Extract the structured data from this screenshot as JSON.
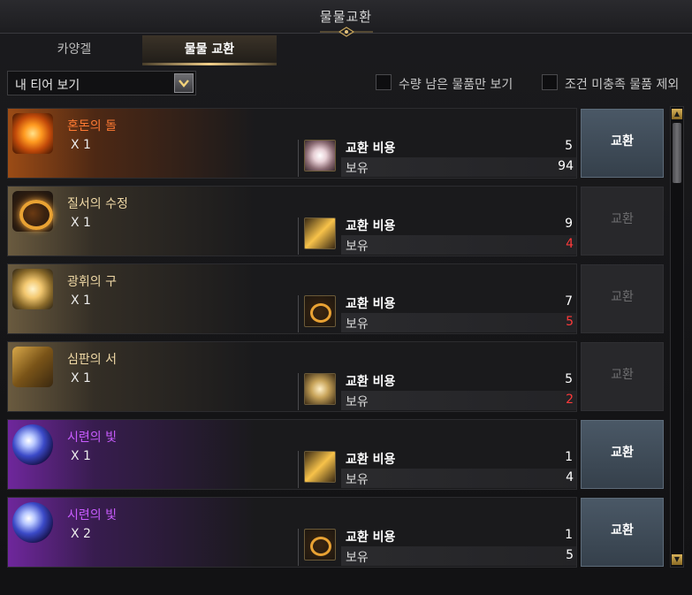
{
  "window": {
    "title": "물물교환",
    "close_icon": "close-icon"
  },
  "tabs": [
    {
      "label": "카양겔",
      "active": false
    },
    {
      "label": "물물 교환",
      "active": true
    }
  ],
  "filters": {
    "tier_select": {
      "value": "내 티어 보기"
    },
    "checkbox_remaining": {
      "label": "수량 남은 물품만 보기",
      "checked": false
    },
    "checkbox_unmet": {
      "label": "조건 미충족 물품 제외",
      "checked": false
    }
  },
  "items": [
    {
      "name": "혼돈의 돌",
      "qty": "X 1",
      "rarity_color": "#ff7a33",
      "icon": "chaos-stone-icon",
      "cost_icon": "gem-icon",
      "cost_label": "교환 비용",
      "cost_value": "5",
      "owned_label": "보유",
      "owned_value": "94",
      "sufficient": true,
      "button_label": "교환",
      "button_enabled": true
    },
    {
      "name": "질서의 수정",
      "qty": "X 1",
      "rarity_color": "#f0d9a6",
      "icon": "order-crystal-icon",
      "cost_icon": "blade-icon",
      "cost_label": "교환 비용",
      "cost_value": "9",
      "owned_label": "보유",
      "owned_value": "4",
      "sufficient": false,
      "button_label": "교환",
      "button_enabled": false
    },
    {
      "name": "광휘의 구",
      "qty": "X 1",
      "rarity_color": "#f0d9a6",
      "icon": "radiance-orb-icon",
      "cost_icon": "ring-icon",
      "cost_label": "교환 비용",
      "cost_value": "7",
      "owned_label": "보유",
      "owned_value": "5",
      "sufficient": false,
      "button_label": "교환",
      "button_enabled": false
    },
    {
      "name": "심판의 서",
      "qty": "X 1",
      "rarity_color": "#f0d9a6",
      "icon": "judgment-book-icon",
      "cost_icon": "orb-icon",
      "cost_label": "교환 비용",
      "cost_value": "5",
      "owned_label": "보유",
      "owned_value": "2",
      "sufficient": false,
      "button_label": "교환",
      "button_enabled": false
    },
    {
      "name": "시련의 빛",
      "qty": "X 1",
      "rarity_color": "#c95cff",
      "icon": "trial-light-icon",
      "cost_icon": "blade-icon",
      "cost_label": "교환 비용",
      "cost_value": "1",
      "owned_label": "보유",
      "owned_value": "4",
      "sufficient": true,
      "button_label": "교환",
      "button_enabled": true
    },
    {
      "name": "시련의 빛",
      "qty": "X 2",
      "rarity_color": "#c95cff",
      "icon": "trial-light-icon",
      "cost_icon": "ring-icon",
      "cost_label": "교환 비용",
      "cost_value": "1",
      "owned_label": "보유",
      "owned_value": "5",
      "sufficient": true,
      "button_label": "교환",
      "button_enabled": true
    }
  ]
}
